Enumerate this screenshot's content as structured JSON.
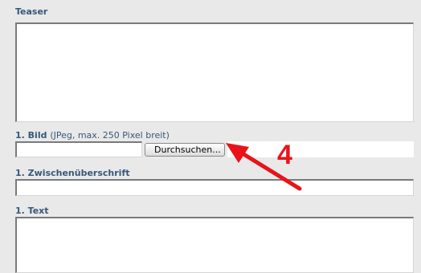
{
  "form": {
    "teaser_label": "Teaser",
    "image_label": "1. Bild",
    "image_note": "(JPeg, max. 250 Pixel breit)",
    "browse_button_label": "Durchsuchen...",
    "subheading_label": "1. Zwischenüberschrift",
    "text_label": "1. Text"
  },
  "annotation": {
    "step_number": "4",
    "color": "#e8141a"
  },
  "colors": {
    "background": "#e9e9e9",
    "label": "#36587a"
  }
}
